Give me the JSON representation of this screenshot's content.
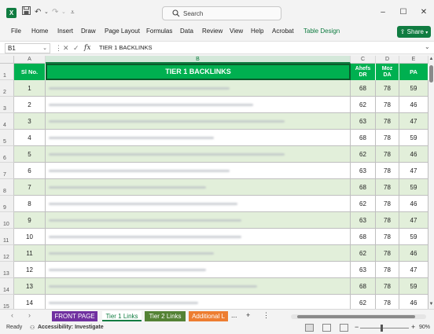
{
  "app": {
    "logo_letter": "X",
    "search_placeholder": "Search",
    "undo_icon": "undo-icon",
    "redo_icon": "redo-icon",
    "save_icon": "save-icon"
  },
  "ribbon": {
    "tabs": [
      "File",
      "Home",
      "Insert",
      "Draw",
      "Page Layout",
      "Formulas",
      "Data",
      "Review",
      "View",
      "Help",
      "Acrobat",
      "Table Design"
    ],
    "share_label": "Share"
  },
  "formula_bar": {
    "name_box": "B1",
    "fx_label": "fx",
    "formula": "TIER 1 BACKLINKS"
  },
  "columns": {
    "letters": [
      "A",
      "B",
      "C",
      "D",
      "E"
    ],
    "selected": "B"
  },
  "table": {
    "headers": {
      "sl": "Sl No.",
      "backlinks": "TIER 1 BACKLINKS",
      "ahrefs_line1": "Ahefs",
      "ahrefs_line2": "DR",
      "moz_line1": "Moz",
      "moz_line2": "DA",
      "pa": "PA"
    },
    "row_numbers": [
      "1",
      "2",
      "3",
      "4",
      "5",
      "6",
      "7",
      "8",
      "9",
      "10",
      "11",
      "12",
      "13",
      "14",
      "15"
    ],
    "rows": [
      {
        "sl": "1",
        "dr": "68",
        "da": "78",
        "pa": "59"
      },
      {
        "sl": "2",
        "dr": "62",
        "da": "78",
        "pa": "46"
      },
      {
        "sl": "3",
        "dr": "63",
        "da": "78",
        "pa": "47"
      },
      {
        "sl": "4",
        "dr": "68",
        "da": "78",
        "pa": "59"
      },
      {
        "sl": "5",
        "dr": "62",
        "da": "78",
        "pa": "46"
      },
      {
        "sl": "6",
        "dr": "63",
        "da": "78",
        "pa": "47"
      },
      {
        "sl": "7",
        "dr": "68",
        "da": "78",
        "pa": "59"
      },
      {
        "sl": "8",
        "dr": "62",
        "da": "78",
        "pa": "46"
      },
      {
        "sl": "9",
        "dr": "63",
        "da": "78",
        "pa": "47"
      },
      {
        "sl": "10",
        "dr": "68",
        "da": "78",
        "pa": "59"
      },
      {
        "sl": "11",
        "dr": "62",
        "da": "78",
        "pa": "46"
      },
      {
        "sl": "12",
        "dr": "63",
        "da": "78",
        "pa": "47"
      },
      {
        "sl": "13",
        "dr": "68",
        "da": "78",
        "pa": "59"
      },
      {
        "sl": "14",
        "dr": "62",
        "da": "78",
        "pa": "46"
      }
    ],
    "colors": {
      "header_green": "#00b050",
      "band_green": "#e2efda",
      "white": "#ffffff"
    }
  },
  "sheets": [
    {
      "label": "FRONT PAGE",
      "color": "#7030a0"
    },
    {
      "label": "Tier 1 Links",
      "color": "#ffffff",
      "active": true
    },
    {
      "label": "Tier 2 Links",
      "color": "#548235"
    },
    {
      "label": "Additional L",
      "color": "#ed7d31"
    }
  ],
  "sheet_more": "...",
  "sheet_add": "+",
  "status": {
    "ready": "Ready",
    "accessibility": "Accessibility: Investigate",
    "zoom": "90%",
    "zoom_minus": "−",
    "zoom_plus": "+"
  }
}
